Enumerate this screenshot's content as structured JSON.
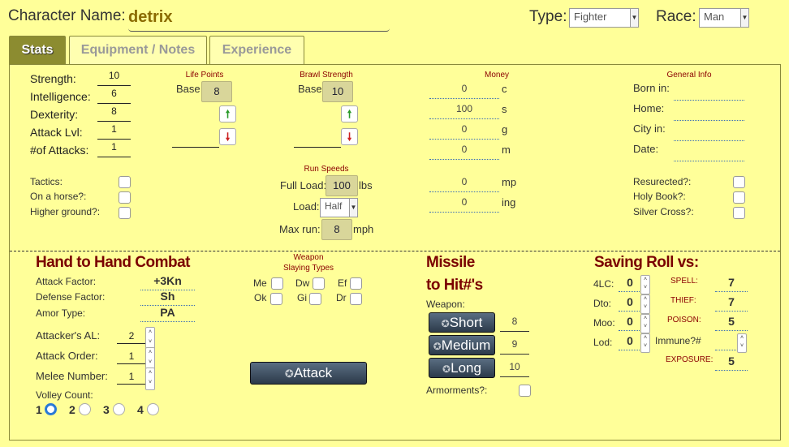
{
  "header": {
    "name_label": "Character Name:",
    "name_value": "detrix",
    "type_label": "Type:",
    "type_value": "Fighter",
    "race_label": "Race:",
    "race_value": "Man"
  },
  "tabs": [
    {
      "label": "Stats"
    },
    {
      "label": "Equipment / Notes"
    },
    {
      "label": "Experience"
    }
  ],
  "stats": {
    "rows": [
      {
        "label": "Strength:",
        "value": "10"
      },
      {
        "label": "Intelligence:",
        "value": "6"
      },
      {
        "label": "Dexterity:",
        "value": "8"
      },
      {
        "label": "Attack Lvl:",
        "value": "1"
      },
      {
        "label": "#of Attacks:",
        "value": "1"
      }
    ]
  },
  "life_points": {
    "title": "Life Points",
    "base_label": "Base",
    "base_value": "8"
  },
  "brawl": {
    "title": "Brawl Strength",
    "base_label": "Base",
    "base_value": "10"
  },
  "money": {
    "title": "Money",
    "rows": [
      {
        "value": "0",
        "unit": "c"
      },
      {
        "value": "100",
        "unit": "s"
      },
      {
        "value": "0",
        "unit": "g"
      },
      {
        "value": "0",
        "unit": "m"
      },
      {
        "value": "0",
        "unit": "mp"
      },
      {
        "value": "0",
        "unit": "ing"
      }
    ]
  },
  "general": {
    "title": "General Info",
    "rows": [
      {
        "label": "Born in:"
      },
      {
        "label": "Home:"
      },
      {
        "label": "City in:"
      },
      {
        "label": "Date:"
      }
    ]
  },
  "conditions": {
    "items": [
      {
        "label": "Tactics:"
      },
      {
        "label": "On a horse?:"
      },
      {
        "label": "Higher ground?:"
      }
    ]
  },
  "run": {
    "title": "Run Speeds",
    "full_label": "Full Load:",
    "full_value": "100",
    "full_unit": "lbs",
    "load_label": "Load:",
    "load_value": "Half",
    "maxrun_label": "Max run:",
    "maxrun_value": "8",
    "maxrun_unit": "mph"
  },
  "misc": {
    "items": [
      {
        "label": "Resurected?:"
      },
      {
        "label": "Holy Book?:"
      },
      {
        "label": "Silver Cross?:"
      }
    ]
  },
  "hth": {
    "title": "Hand to Hand Combat",
    "attack_factor_label": "Attack Factor:",
    "attack_factor": "+3Kn",
    "defense_factor_label": "Defense Factor:",
    "defense_factor": "Sh",
    "armor_type_label": "Amor Type:",
    "armor_type": "PA",
    "attackers_al_label": "Attacker's AL:",
    "attackers_al": "2",
    "attack_order_label": "Attack Order:",
    "attack_order": "1",
    "melee_label": "Melee Number:",
    "melee": "1",
    "volley_label": "Volley Count:",
    "volley": [
      "1",
      "2",
      "3",
      "4"
    ],
    "attack_button": "Attack"
  },
  "slaying": {
    "title1": "Weapon",
    "title2": "Slaying Types",
    "items": [
      "Me",
      "Dw",
      "Ef",
      "Ok",
      "Gi",
      "Dr"
    ]
  },
  "missile": {
    "title1": "Missile",
    "title2": "to Hit#'s",
    "weapon_label": "Weapon:",
    "ranges": [
      {
        "label": "Short",
        "value": "8"
      },
      {
        "label": "Medium",
        "value": "9"
      },
      {
        "label": "Long",
        "value": "10"
      }
    ],
    "armorments_label": "Armorments?:"
  },
  "saving": {
    "title": "Saving Roll vs:",
    "left": [
      {
        "label": "4LC:",
        "value": "0"
      },
      {
        "label": "Dto:",
        "value": "0"
      },
      {
        "label": "Moo:",
        "value": "0"
      },
      {
        "label": "Lod:",
        "value": "0"
      }
    ],
    "spell_label": "SPELL:",
    "spell": "7",
    "thief_label": "THIEF:",
    "thief": "7",
    "poison_label": "POISON:",
    "poison": "5",
    "immune_label": "Immune?#",
    "exposure_label": "EXPOSURE:",
    "exposure": "5"
  }
}
